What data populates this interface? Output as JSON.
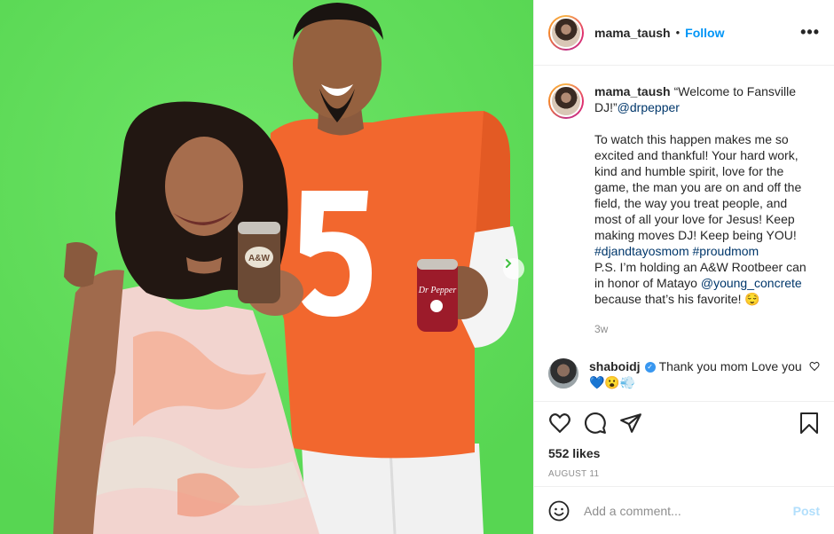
{
  "post": {
    "photo_description_icon": "photo",
    "can_text_left": "A&W",
    "can_text_right": "Dr Pepper",
    "jersey_number": "5"
  },
  "header": {
    "username": "mama_taush",
    "separator": "•",
    "follow_label": "Follow",
    "more_icon": "more-horizontal-icon",
    "more_label": "•••"
  },
  "caption": {
    "username": "mama_taush",
    "line1_text": "“Welcome to Fansville DJ!”",
    "line1_mention": "@drpepper",
    "paragraph2": "To watch this happen makes me so excited and thankful! Your hard work, kind and humble spirit, love for the game, the man you are on and off the field, the way you treat people, and most of all your love for Jesus! Keep making moves DJ! Keep being YOU!",
    "hashtag1": "#djandtayosmom",
    "hashtag2": "#proudmom",
    "ps_text": "P.S. I’m holding an A&W Rootbeer can in honor of Matayo",
    "ps_mention": "@young_concrete",
    "ps_end": "because that’s his favorite! 😌",
    "time": "3w"
  },
  "reply": {
    "username": "shaboidj",
    "verified_mark": "✓",
    "text": "Thank you mom Love you 💙😮💨"
  },
  "actions": {
    "likes": "552 likes",
    "date": "AUGUST 11"
  },
  "add_comment": {
    "placeholder": "Add a comment...",
    "post_label": "Post"
  },
  "colors": {
    "accent": "#0095f6",
    "photo_bg": "#5fe05a",
    "jersey": "#f2672e"
  }
}
